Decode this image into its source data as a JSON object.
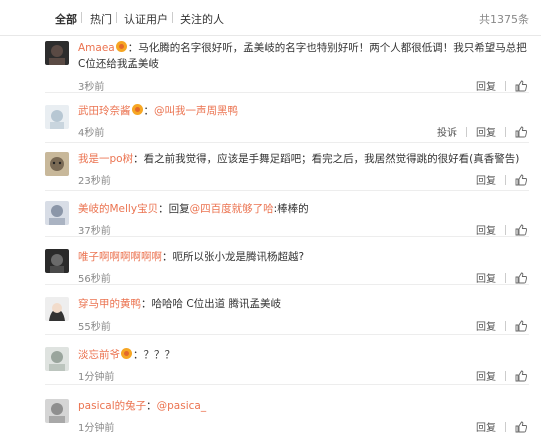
{
  "tabs": {
    "all": "全部",
    "hot": "热门",
    "verified": "认证用户",
    "following": "关注的人",
    "total": "共1375条"
  },
  "actions": {
    "reply": "回复",
    "report": "投诉"
  },
  "colors": {
    "username": "#eb7350",
    "time": "#888888",
    "divider": "#ededed"
  },
  "comments": [
    {
      "user": "Amaea",
      "text": "：马化腾的名字很好听，孟美岐的名字也特别好听！两个人都很低调！我只希望马总把C位还给我孟美岐",
      "time": "3秒前",
      "avatar_colors": [
        "#2d2d2d",
        "#5a4a44"
      ]
    },
    {
      "user": "武田玲奈酱",
      "text_prefix": "：",
      "mention": "@叫我一声周黑鸭",
      "time": "4秒前",
      "avatar_colors": [
        "#e9eef2",
        "#b7c7d3"
      ]
    },
    {
      "user": "我是一po树",
      "text": "：看之前我觉得，应该是手舞足蹈吧；看完之后，我居然觉得跳的很好看(真香警告)",
      "time": "23秒前",
      "avatar_colors": [
        "#c8b89a",
        "#7a6a55"
      ]
    },
    {
      "user": "美岐的Melly宝贝",
      "text_prefix": "：回复",
      "mention": "@四百度就够了哈",
      "text_suffix": ":棒棒的",
      "time": "37秒前",
      "avatar_colors": [
        "#d8dde6",
        "#8b96a8"
      ]
    },
    {
      "user": "唯子啊啊啊啊啊啊",
      "text": "：呃所以张小龙是腾讯杨超越?",
      "time": "56秒前",
      "avatar_colors": [
        "#2a2a2a",
        "#6a6a6a"
      ]
    },
    {
      "user": "穿马甲的黄鸭",
      "text": "：哈哈哈 C位出道 腾讯孟美岐",
      "time": "55秒前",
      "avatar_colors": [
        "#eeeeee",
        "#333333"
      ]
    },
    {
      "user": "淡忘前爷",
      "text": "：？？？",
      "time": "1分钟前",
      "avatar_colors": [
        "#dfe3e0",
        "#9aa59d"
      ]
    },
    {
      "user": "pasical的兔子",
      "text_prefix": "：",
      "mention": "@pasica_",
      "time": "1分钟前",
      "avatar_colors": [
        "#d5d5d5",
        "#8f8f8f"
      ]
    }
  ]
}
